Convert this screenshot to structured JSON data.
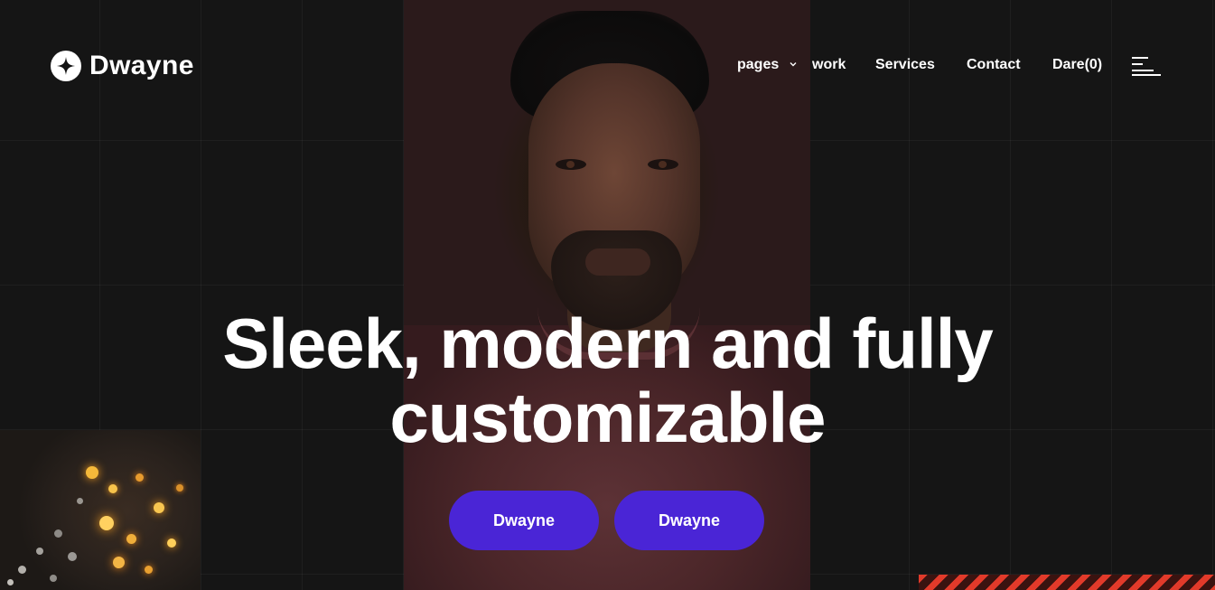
{
  "header": {
    "logo_text": "Dwayne",
    "nav": [
      {
        "label": "pages",
        "has_dropdown": true
      },
      {
        "label": "work"
      },
      {
        "label": "Services"
      },
      {
        "label": "Contact"
      },
      {
        "label": "Dare(0)"
      }
    ],
    "menu_icon": "hamburger-menu-icon"
  },
  "hero": {
    "headline_line1": "Sleek, modern and fully",
    "headline_line2": "customizable",
    "buttons": [
      {
        "label": "Dwayne"
      },
      {
        "label": "Dwayne"
      }
    ]
  },
  "colors": {
    "background": "#151515",
    "accent": "#4a25d6",
    "text": "#ffffff"
  }
}
